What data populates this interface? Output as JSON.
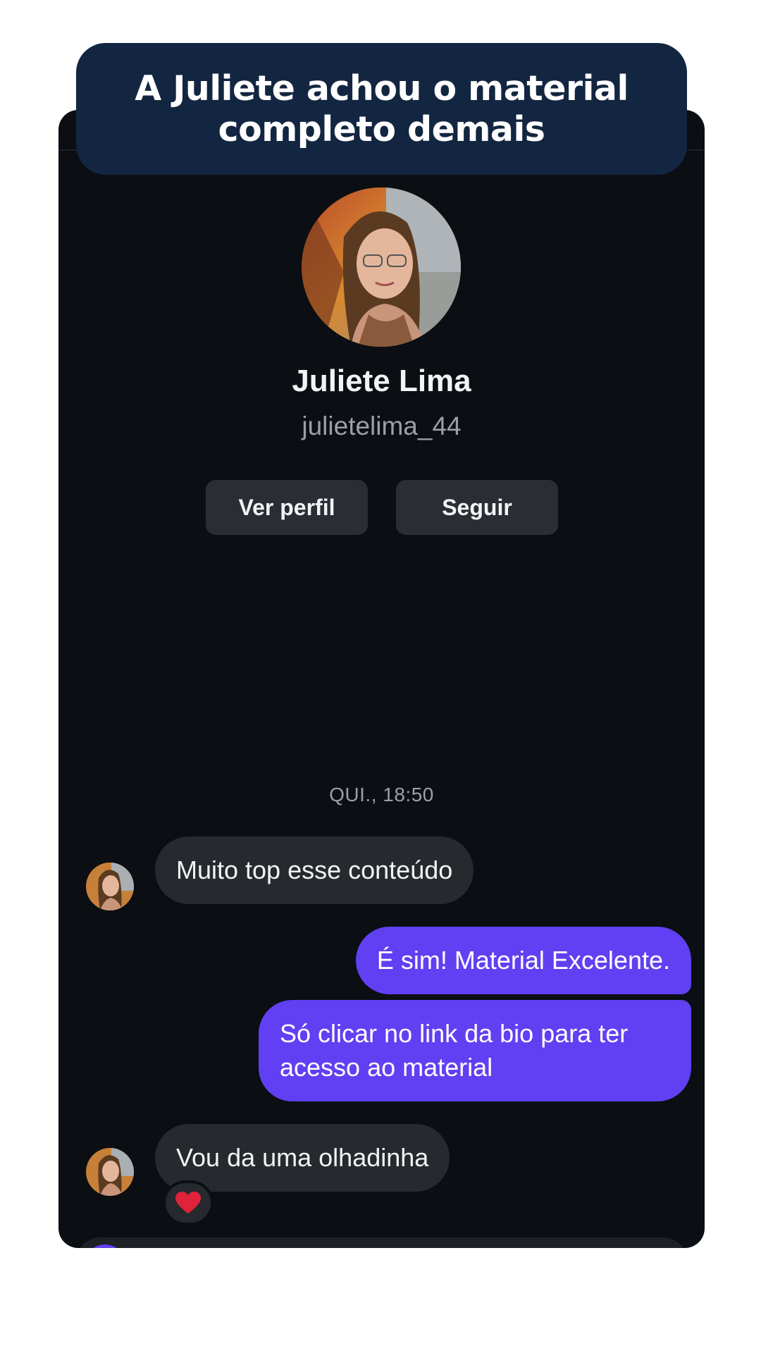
{
  "banner": {
    "title": "A Juliete achou o material completo demais"
  },
  "profile": {
    "name": "Juliete Lima",
    "username": "julietelima_44",
    "view_profile_label": "Ver perfil",
    "follow_label": "Seguir"
  },
  "conversation": {
    "timestamp": "QUI., 18:50",
    "messages": [
      {
        "direction": "incoming",
        "text": "Muito top esse conteúdo"
      },
      {
        "direction": "outgoing",
        "text": "É sim! Material Excelente."
      },
      {
        "direction": "outgoing",
        "text": "Só clicar no link da bio para ter acesso ao material"
      },
      {
        "direction": "incoming",
        "text": "Vou da uma olhadinha",
        "reaction": "heart-icon"
      }
    ]
  },
  "colors": {
    "banner_bg": "#132641",
    "chat_bg": "#0b0e12",
    "incoming_bubble": "#26292e",
    "outgoing_bubble": "#6040f2",
    "reaction_heart": "#e0223b"
  }
}
